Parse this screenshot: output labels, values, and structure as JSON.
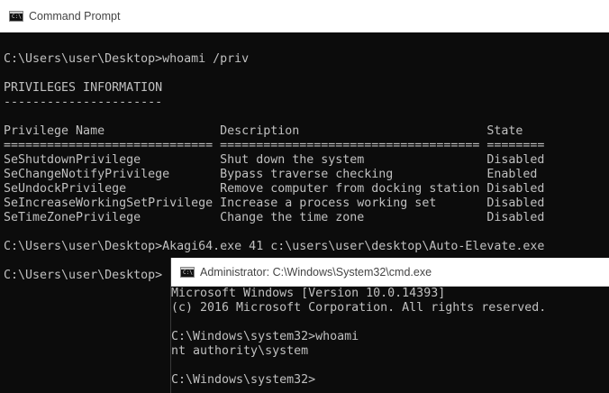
{
  "window1": {
    "title": "Command Prompt",
    "lines": [
      "",
      "C:\\Users\\user\\Desktop>whoami /priv",
      "",
      "PRIVILEGES INFORMATION",
      "----------------------",
      "",
      "Privilege Name                Description                          State",
      "============================= ==================================== ========",
      "SeShutdownPrivilege           Shut down the system                 Disabled",
      "SeChangeNotifyPrivilege       Bypass traverse checking             Enabled",
      "SeUndockPrivilege             Remove computer from docking station Disabled",
      "SeIncreaseWorkingSetPrivilege Increase a process working set       Disabled",
      "SeTimeZonePrivilege           Change the time zone                 Disabled",
      "",
      "C:\\Users\\user\\Desktop>Akagi64.exe 41 c:\\users\\user\\desktop\\Auto-Elevate.exe",
      "",
      "C:\\Users\\user\\Desktop>"
    ]
  },
  "window2": {
    "title": "Administrator: C:\\Windows\\System32\\cmd.exe",
    "lines": [
      "Microsoft Windows [Version 10.0.14393]",
      "(c) 2016 Microsoft Corporation. All rights reserved.",
      "",
      "C:\\Windows\\system32>whoami",
      "nt authority\\system",
      "",
      "C:\\Windows\\system32>"
    ]
  },
  "colors": {
    "console_bg": "#0c0c0c",
    "console_text": "#c0c0c0",
    "titlebar_bg": "#ffffff"
  },
  "icons": {
    "window1": "command-prompt-icon",
    "window2": "command-prompt-icon"
  }
}
